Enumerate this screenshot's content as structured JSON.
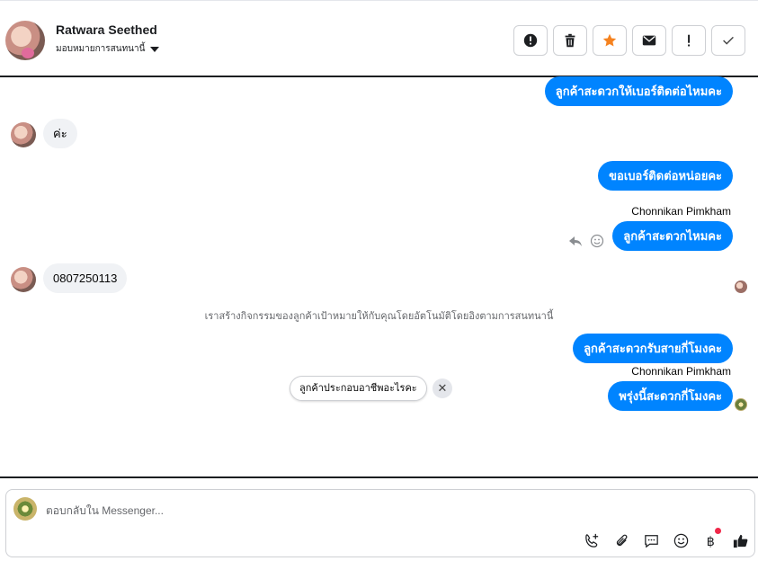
{
  "header": {
    "name": "Ratwara Seethed",
    "assign_label": "มอบหมายการสนทนานี้"
  },
  "toolbar": {
    "buttons": [
      "alert-circle-icon",
      "trash-icon",
      "star-icon",
      "envelope-icon",
      "exclamation-icon",
      "check-icon"
    ],
    "star_color": "#f5821f"
  },
  "messages": [
    {
      "dir": "out",
      "text": "ลูกค้าสะดวกให้เบอร์ติดต่อไหมคะ"
    },
    {
      "dir": "in",
      "text": "ค่ะ"
    },
    {
      "dir": "out",
      "text": "ขอเบอร์ติดต่อหน่อยคะ"
    },
    {
      "dir": "out",
      "sender": "Chonnikan Pimkham",
      "text": "ลูกค้าสะดวกไหมคะ"
    },
    {
      "dir": "in",
      "text": "0807250113"
    },
    {
      "dir": "out",
      "text": "ลูกค้าสะดวกรับสายกี่โมงคะ"
    },
    {
      "dir": "out",
      "sender": "Chonnikan Pimkham",
      "text": "พรุ่งนี้สะดวกกี่โมงคะ"
    }
  ],
  "system_note": "เราสร้างกิจกรรมของลูกค้าเป้าหมายให้กับคุณโดยอัตโนมัติโดยอิงตามการสนทนานี้",
  "suggestion_chip": "ลูกค้าประกอบอาชีพอะไรคะ",
  "composer": {
    "placeholder": "ตอบกลับใน Messenger..."
  },
  "colors": {
    "accent": "#0084ff",
    "incoming_bubble": "#f0f2f5",
    "notification": "#f02849"
  }
}
